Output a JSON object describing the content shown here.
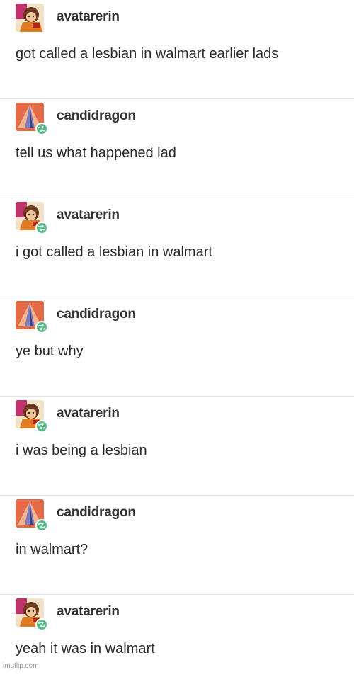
{
  "posts": [
    {
      "user": "avatarerin",
      "avatar": "avatarerin-avatar-icon",
      "reblog": false,
      "text": "got called a lesbian in walmart earlier lads"
    },
    {
      "user": "candidragon",
      "avatar": "candidragon-avatar-icon",
      "reblog": true,
      "text": "tell us what happened lad"
    },
    {
      "user": "avatarerin",
      "avatar": "avatarerin-avatar-icon",
      "reblog": true,
      "text": "i got called a lesbian in walmart"
    },
    {
      "user": "candidragon",
      "avatar": "candidragon-avatar-icon",
      "reblog": true,
      "text": "ye but why"
    },
    {
      "user": "avatarerin",
      "avatar": "avatarerin-avatar-icon",
      "reblog": true,
      "text": "i was being a lesbian"
    },
    {
      "user": "candidragon",
      "avatar": "candidragon-avatar-icon",
      "reblog": true,
      "text": "in walmart?"
    },
    {
      "user": "avatarerin",
      "avatar": "avatarerin-avatar-icon",
      "reblog": true,
      "text": "yeah it was in walmart"
    }
  ],
  "colors": {
    "reblog_badge": "#56bc8a",
    "divider": "#e2e2e2"
  },
  "watermark": "imgflip.com"
}
